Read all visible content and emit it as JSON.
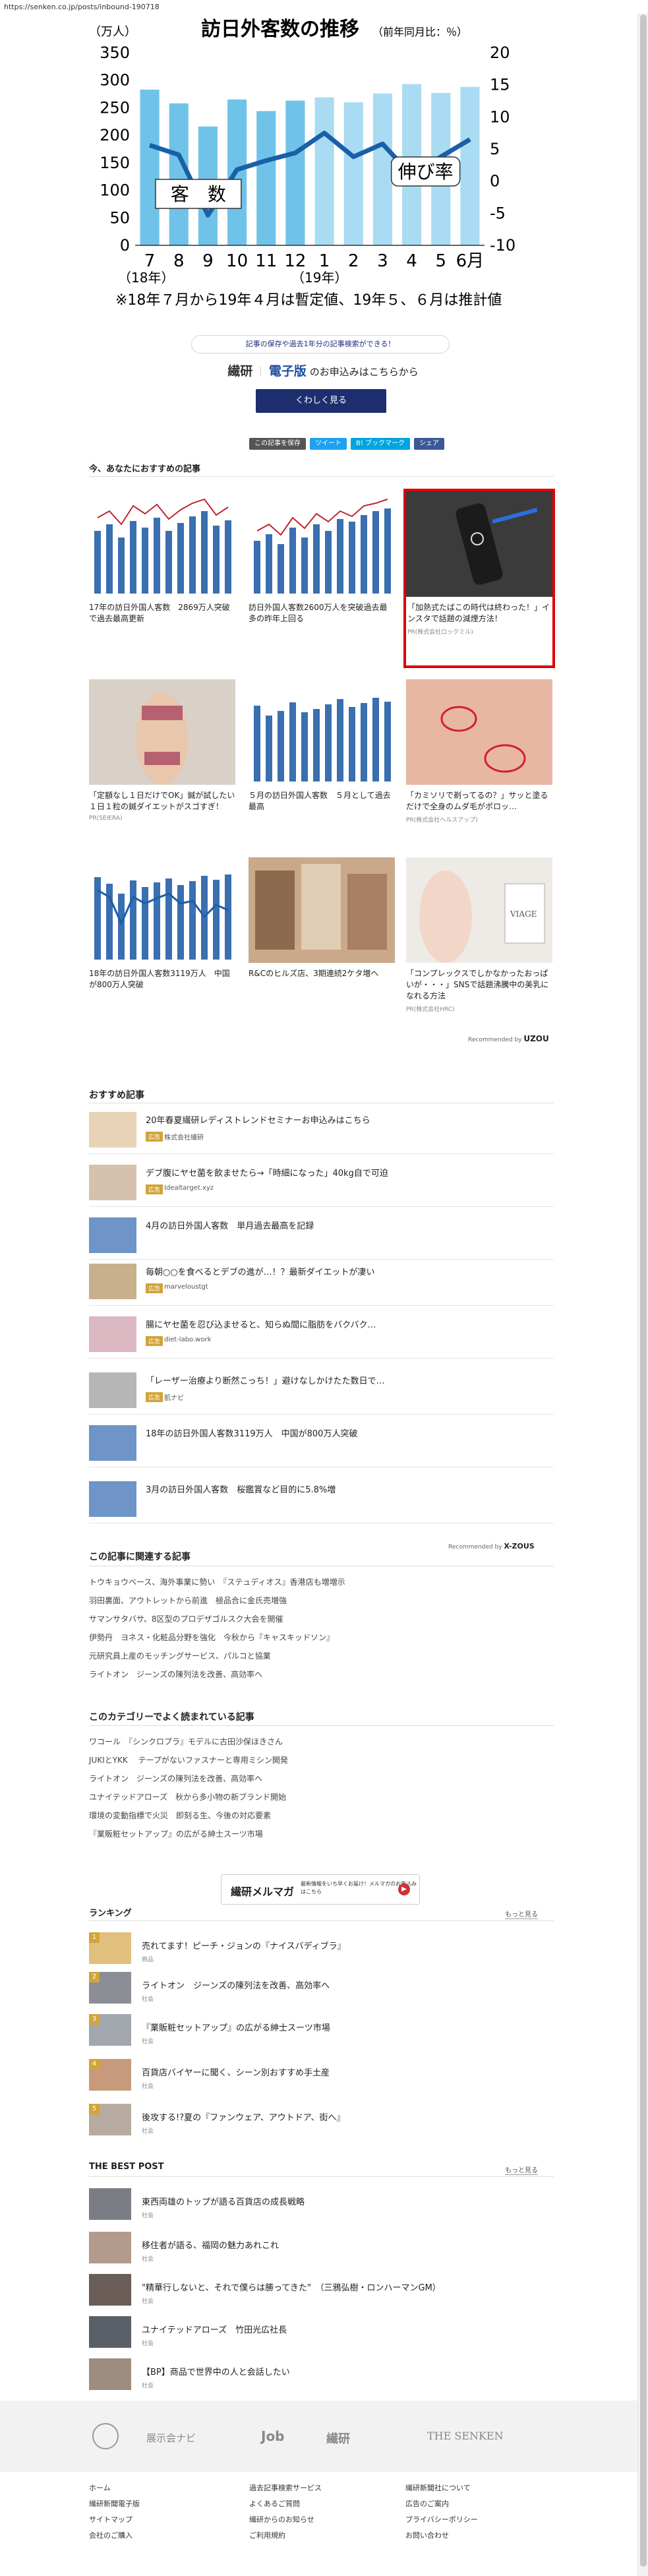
{
  "url": "https://senken.co.jp/posts/inbound-190718",
  "hero": {
    "title": "訪日外客数の推移",
    "title_note": "（前年同月比：％）",
    "unit_left": "（万人）",
    "label_bars": "客　数",
    "label_line": "伸び率",
    "note": "※18年７月から19年４月は暫定値、19年５、６月は推計値",
    "x_labels": [
      "7",
      "8",
      "9",
      "10",
      "11",
      "12",
      "1",
      "2",
      "3",
      "4",
      "5",
      "6月"
    ],
    "x_sub_left": "（18年）",
    "x_sub_mid": "（19年）",
    "y_left_ticks": [
      "350",
      "300",
      "250",
      "200",
      "150",
      "100",
      "50",
      "0"
    ],
    "y_right_ticks": [
      "20",
      "15",
      "10",
      "5",
      "0",
      "-5",
      "-10"
    ]
  },
  "chart_data": {
    "type": "bar",
    "title": "訪日外客数の推移",
    "categories": [
      "7",
      "8",
      "9",
      "10",
      "11",
      "12",
      "1",
      "2",
      "3",
      "4",
      "5",
      "6月"
    ],
    "series": [
      {
        "name": "客　数",
        "values": [
          283,
          258,
          216,
          265,
          244,
          263,
          269,
          260,
          276,
          293,
          277,
          288
        ]
      },
      {
        "name": "伸び率",
        "values": [
          5.6,
          4.1,
          -5.3,
          1.8,
          3.2,
          4.4,
          7.5,
          3.8,
          5.8,
          0.9,
          3.8,
          6.5
        ]
      }
    ],
    "ylim": [
      0,
      350
    ],
    "y2lim": [
      -10,
      20
    ],
    "ylabel": "（万人）",
    "y2label": "（前年同月比：％）",
    "bar_colors": [
      "#6fc3e8",
      "#a9dcf2"
    ],
    "line_color": "#1a5fa8"
  },
  "promo": {
    "band_text": "記事の保存や過去1年分の記事検索ができる！",
    "logo_left": "繊研",
    "logo_right": "電子版",
    "tail": "のお申込みはこちらから",
    "cta": "くわしく見る"
  },
  "share": [
    {
      "label": "この記事を保存",
      "color": "#555555"
    },
    {
      "label": "ツイート",
      "color": "#1da1f2"
    },
    {
      "label": "B! ブックマーク",
      "color": "#00a4de"
    },
    {
      "label": "シェア",
      "color": "#3b5998"
    }
  ],
  "recommended_title": "今、あなたにおすすめの記事",
  "cards": [
    {
      "title": "17年の訪日外国人客数　2869万人突破で過去最高更新",
      "src": ""
    },
    {
      "title": "訪日外国人客数2600万人を突破過去最多の昨年上回る",
      "src": ""
    },
    {
      "title": "「加熱式たばこの時代は終わった！」インスタで話題の減煙方法！",
      "src": "PR(株式会社ロックミル)"
    },
    {
      "title": "「定額なし１日だけでOK」鍼が試したい１日１粒の鍼ダイエットがスゴすぎ！",
      "src": "PR(SEIERA)"
    },
    {
      "title": "５月の訪日外国人客数　５月として過去最高",
      "src": ""
    },
    {
      "title": "「カミソリで剃ってるの？」サッと塗るだけで全身のムダ毛がポロッ…",
      "src": "PR(株式会社ヘルスアップ)"
    },
    {
      "title": "18年の訪日外国人客数3119万人　中国が800万人突破",
      "src": ""
    },
    {
      "title": "R&Cのヒルズ店、3期連続2ケタ増へ",
      "src": ""
    },
    {
      "title": "「コンプレックスでしかなかったおっぱいが・・・」SNSで話題沸騰中の美乳になれる方法",
      "src": "PR(株式会社HRC)"
    }
  ],
  "recommended_by": "Recommended by",
  "recommended_brand": "UZOU",
  "osusume_title": "おすすめ記事",
  "osusume": [
    {
      "title": "20年春夏繊研レディストレンドセミナーお申込みはこちら",
      "tag": "広告",
      "site": "株式会社繊研"
    },
    {
      "title": "デブ腹にヤセ菌を飲ませたら→「時細になった」40kg自で可迫",
      "tag": "広告",
      "site": "Idealtarget.xyz"
    },
    {
      "title": "4月の訪日外国人客数　単月過去最高を記録",
      "tag": "",
      "site": ""
    },
    {
      "title": "毎朝○○を食べるとデブの進が…！？最新ダイエットが凄い",
      "tag": "広告",
      "site": "marveloustgt"
    },
    {
      "title": "腸にヤセ菌を忍び込ませると、知らぬ間に脂肪をバクバク…",
      "tag": "広告",
      "site": "diet-labo.work"
    },
    {
      "title": "「レーザー治療より断然こっち！」避けなしかけたた数日で…",
      "tag": "広告",
      "site": "肌ナビ"
    },
    {
      "title": "18年の訪日外国人客数3119万人　中国が800万人突破",
      "tag": "",
      "site": ""
    },
    {
      "title": "3月の訪日外国人客数　桜鑑賞など目的に5.8%増",
      "tag": "",
      "site": ""
    }
  ],
  "recommended_by2": "Recommended by",
  "recommended_brand2": "X-ZOUS",
  "related_title": "この記事に関連する記事",
  "related": [
    "トウキョウベース、海外事業に勢い　『ステュディオス』香港店も増増示",
    "羽田裏面、アウトレットから前進　極品合に金氏売増強",
    "サマンサタバサ、8区型のプロデザゴルスク大会を開催",
    "伊勢丹　ヨネス・化粧品分野を強化　今秋から『キャスキッドソン』",
    "元研究員上産のモッチングサービス、パルコと協業",
    "ライトオン　ジーンズの陳列法を改善、高効率へ"
  ],
  "popular_title": "このカテゴリーでよく読まれている記事",
  "popular": [
    "ワコール　『シンクロブラ』モデルに古田沙保ほきさん",
    "JUKIとYKK 　テープがないファスナーと専用ミシン開発",
    "ライトオン　ジーンズの陳列法を改善、高効率へ",
    "ユナイテッドアローズ　秋から多小物の新ブランド開始",
    "環境の変動指標で火災　即刻る生、今後の対応要素",
    "『業販粧セットアップ』の広がる紳士スーツ市場"
  ],
  "mailmag": {
    "name": "繊研メルマガ",
    "desc": "最新情報をいち早くお届け！メルマガのお申込みはこちら",
    "go": "▶"
  },
  "ranking_title": "ランキング",
  "ranking_more": "もっと見る",
  "ranking": [
    {
      "num": "1",
      "title": "売れてます！ピーチ・ジョンの『ナイスバディブラ』",
      "cat": "商品"
    },
    {
      "num": "2",
      "title": "ライトオン　ジーンズの陳列法を改善、高効率へ",
      "cat": "社会"
    },
    {
      "num": "3",
      "title": "『業販粧セットアップ』の広がる紳士スーツ市場",
      "cat": "社会"
    },
    {
      "num": "4",
      "title": "百貨店バイヤーに聞く、シーン別おすすめ手土産",
      "cat": "社会"
    },
    {
      "num": "5",
      "title": "後攻する!?夏の『ファンウェア、アウトドア、街へ』",
      "cat": "社会"
    }
  ],
  "bestpost_title": "THE BEST POST",
  "bestpost_more": "もっと見る",
  "bestpost": [
    {
      "title": "東西両雄のトップが語る百貨店の成長戦略",
      "cat": "社会"
    },
    {
      "title": "移住者が語る、福岡の魅力あれこれ",
      "cat": "社会"
    },
    {
      "title": "\"精華行しないと、それで僕らは勝ってきた\"　（三鴉弘樹・ロンハーマンGM）",
      "cat": "社会"
    },
    {
      "title": "ユナイテッドアローズ　竹田光広社長",
      "cat": "社会"
    },
    {
      "title": "【BP】商品で世界中の人と会話したい",
      "cat": "社会"
    }
  ],
  "footer_logos": [
    "展示会ナビ",
    "Job",
    "繊研",
    "THE SENKEN"
  ],
  "footer_col1": [
    "ホーム",
    "繊研新聞電子版",
    "サイトマップ",
    "会社のご購入"
  ],
  "footer_col2": [
    "過去記事検索サービス",
    "よくあるご質問",
    "繊研からのお知らせ",
    "ご利用規約"
  ],
  "footer_col3": [
    "繊研新聞社について",
    "広告のご案内",
    "プライバシーポリシー",
    "お問い合わせ"
  ]
}
